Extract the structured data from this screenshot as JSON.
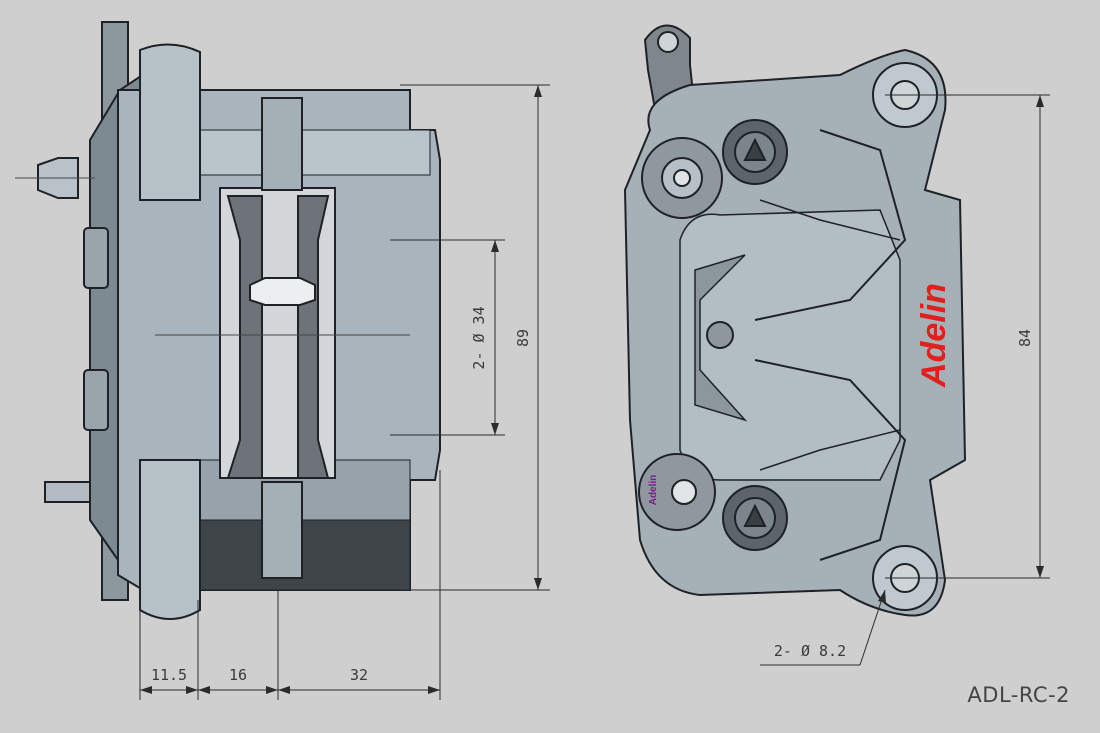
{
  "drawing": {
    "model_code": "ADL-RC-2",
    "brand_logo_text": "Adelin",
    "small_logo_text": "Adelin",
    "colors": {
      "background": "#cfcfcf",
      "body": "#a9b4bc",
      "body_dark": "#6f7a82",
      "outline": "#1e2226",
      "dimension_line": "#2b2b2b",
      "logo_red": "#e0201c"
    }
  },
  "dimensions": {
    "height_side": "89",
    "piston_diameter": "2- Ø 34",
    "mount_spacing": "84",
    "hole_diameter": "2- Ø 8.2",
    "width_a": "11.5",
    "width_b": "16",
    "width_c": "32"
  }
}
